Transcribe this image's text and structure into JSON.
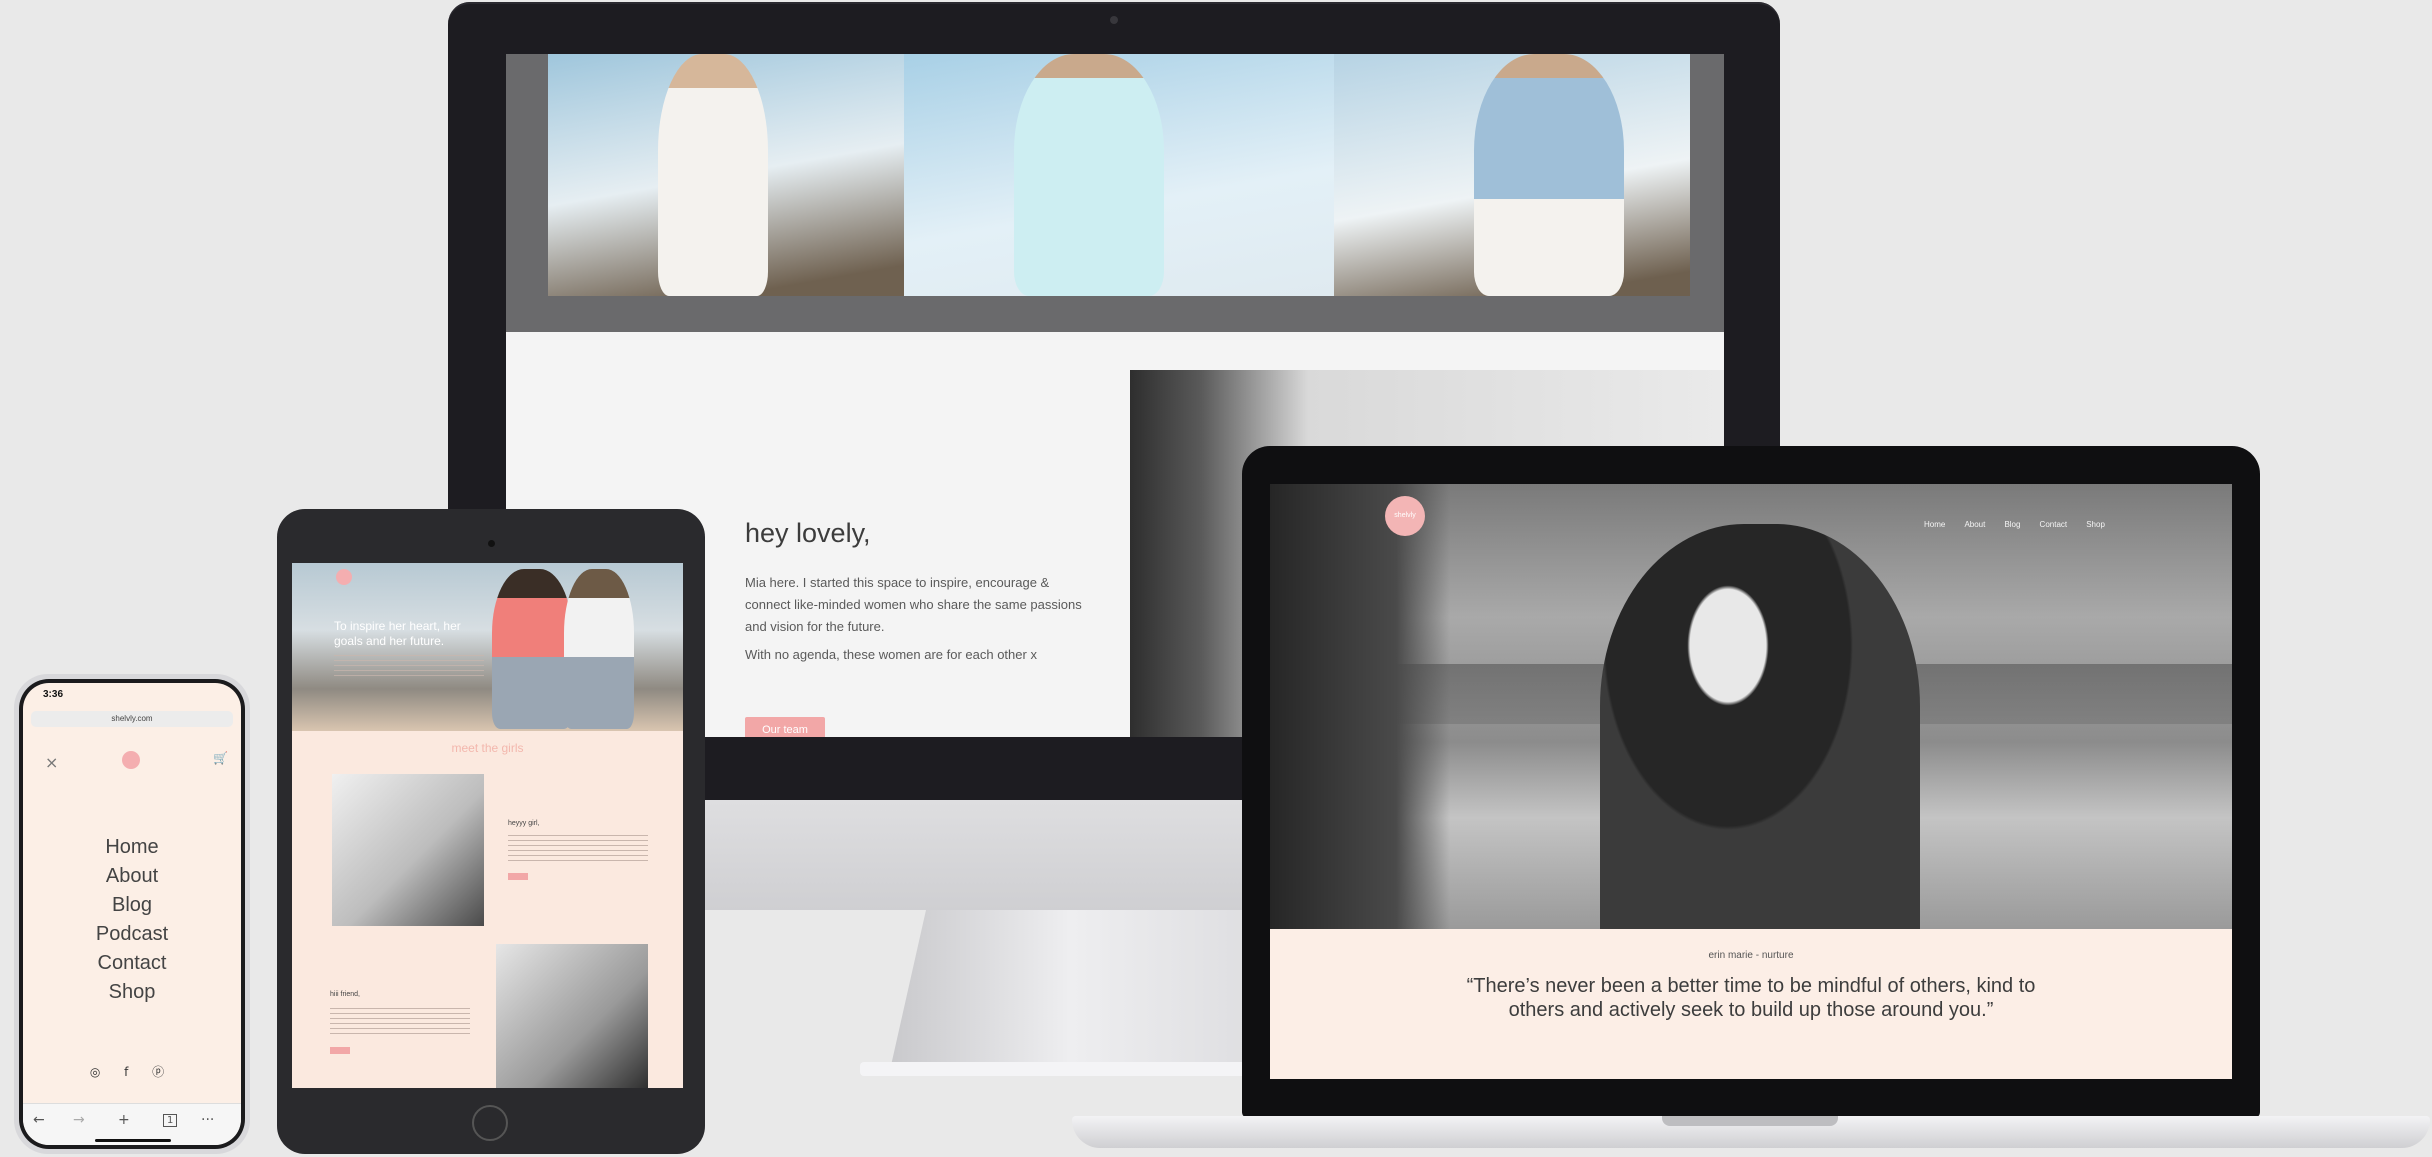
{
  "desktop": {
    "intro_heading": "hey lovely,",
    "intro_paragraph": "Mia here. I started this space to inspire, encourage & connect like-minded women who share the same passions and vision for the future.",
    "intro_paragraph2": "With no agenda, these women are for each other x",
    "cta_label": "Our team"
  },
  "tablet": {
    "headline": "To inspire her heart, her goals and her future.",
    "section_title": "meet the girls",
    "member1_name": "heyyy girl,",
    "member2_name": "hiii friend,"
  },
  "phone": {
    "time": "3:36",
    "url": "shelvly.com",
    "close_icon": "×",
    "cart_icon": "🛒",
    "nav_items": [
      "Home",
      "About",
      "Blog",
      "Podcast",
      "Contact",
      "Shop"
    ],
    "social_icons": [
      "instagram-icon",
      "facebook-icon",
      "pinterest-icon"
    ],
    "social_glyphs": "◎ f ⓟ",
    "toolbar": {
      "back": "←",
      "forward": "→",
      "add": "+",
      "tabs": "1",
      "more": "···"
    }
  },
  "laptop": {
    "logo_text": "shelvly",
    "nav_items": [
      "Home",
      "About",
      "Blog",
      "Contact",
      "Shop"
    ],
    "caption": "erin marie - nurture",
    "quote": "“There’s never been a better time to be mindful of others, kind to others and actively seek to build up those around you.”"
  },
  "colors": {
    "accent_pink": "#f2a7a7",
    "background_peach": "#fceee6",
    "device_dark": "#1d1c21"
  }
}
